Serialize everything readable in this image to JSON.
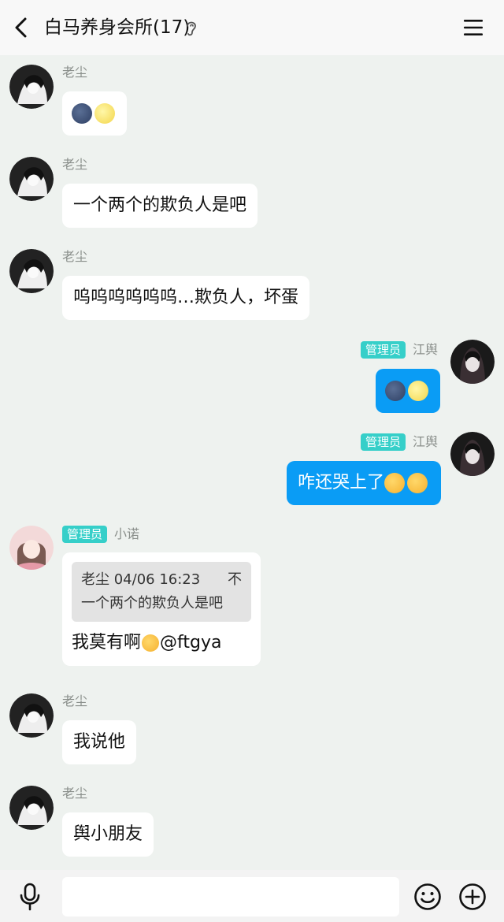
{
  "header": {
    "title": "白马养身会所(17)",
    "back_icon": "chevron-left-icon",
    "ear_icon": "ear-icon",
    "menu_icon": "menu-icon"
  },
  "messages": [
    {
      "sender": "老尘",
      "side": "left",
      "badge": "",
      "text": "",
      "emojis": [
        "new-moon-face",
        "full-moon-face"
      ]
    },
    {
      "sender": "老尘",
      "side": "left",
      "badge": "",
      "text": "一个两个的欺负人是吧"
    },
    {
      "sender": "老尘",
      "side": "left",
      "badge": "",
      "text": "呜呜呜呜呜呜…欺负人，坏蛋"
    },
    {
      "sender": "江舆",
      "side": "right",
      "badge": "管理员",
      "text": "",
      "emojis": [
        "new-moon-face",
        "full-moon-face"
      ]
    },
    {
      "sender": "江舆",
      "side": "right",
      "badge": "管理员",
      "text": "咋还哭上了",
      "emojis": [
        "tongue-face",
        "tongue-face"
      ]
    },
    {
      "sender": "小诺",
      "side": "left",
      "badge": "管理员",
      "quote": {
        "author_time": "老尘 04/06 16:23",
        "text": "一个两个的欺负人是吧",
        "pin": "不"
      },
      "text_before": "我莫有啊",
      "text_after": "@ftgya",
      "emojis": [
        "grin-face"
      ]
    },
    {
      "sender": "老尘",
      "side": "left",
      "badge": "",
      "text": "我说他"
    },
    {
      "sender": "老尘",
      "side": "left",
      "badge": "",
      "text": "舆小朋友"
    }
  ],
  "input": {
    "value": "",
    "placeholder": "",
    "mic_icon": "microphone-icon",
    "emoji_icon": "smiley-icon",
    "plus_icon": "plus-circle-icon"
  },
  "colors": {
    "background": "#eef2ef",
    "outgoing_bubble": "#0a9cf5",
    "admin_badge": "#36cfc9"
  }
}
